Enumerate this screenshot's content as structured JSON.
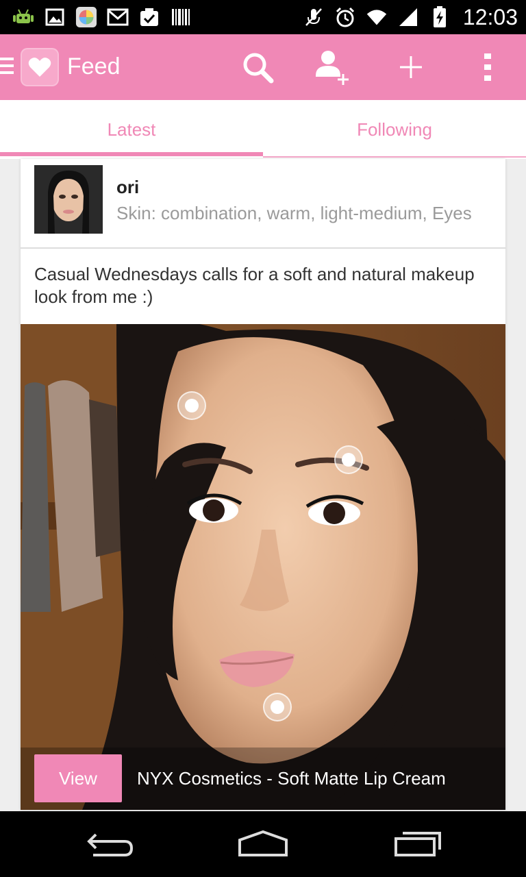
{
  "status_bar": {
    "time": "12:03",
    "left_icons": [
      "android-debug-icon",
      "image-icon",
      "app-icon",
      "gmail-icon",
      "clipboard-check-icon",
      "barcode-icon"
    ],
    "right_icons": [
      "mute-icon",
      "alarm-icon",
      "wifi-icon",
      "signal-icon",
      "battery-icon"
    ]
  },
  "app_bar": {
    "title": "Feed",
    "accent_color": "#f088b6",
    "actions": [
      "search-icon",
      "add-person-icon",
      "plus-icon",
      "overflow-menu-icon"
    ]
  },
  "tabs": [
    {
      "label": "Latest",
      "selected": true
    },
    {
      "label": "Following",
      "selected": false
    }
  ],
  "post": {
    "username": "ori",
    "skin_info": "Skin: combination, warm, light-medium, Eyes",
    "caption": "Casual Wednesdays calls for a soft and natural makeup look from me :)",
    "tag_count": 3,
    "product": {
      "button_label": "View",
      "name": "NYX Cosmetics - Soft Matte Lip Cream"
    }
  },
  "nav_bar": {
    "buttons": [
      "back-icon",
      "home-icon",
      "recents-icon"
    ]
  }
}
